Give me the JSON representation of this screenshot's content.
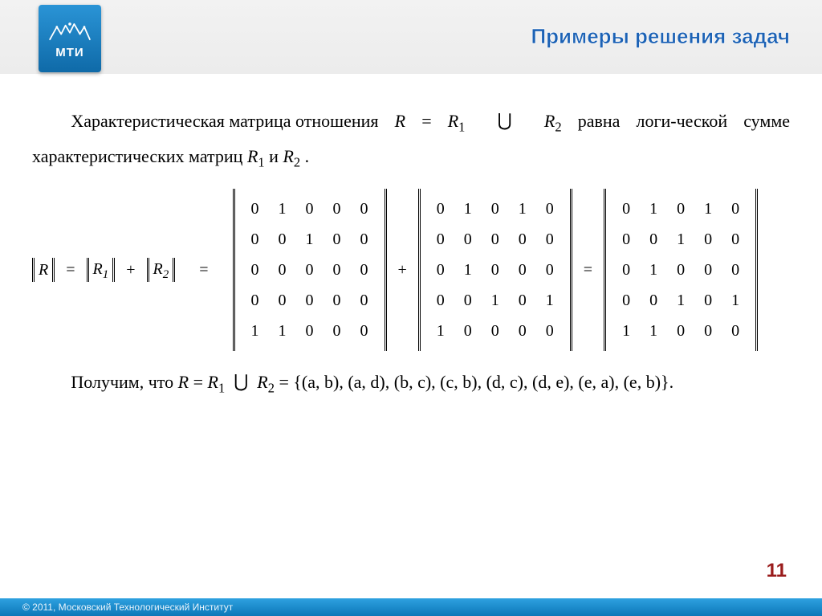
{
  "logo_text": "МТИ",
  "slide_title": "Примеры решения  задач",
  "para1_a": "Характеристическая матрица отношения ",
  "para1_b": " равна логи-ческой сумме характеристических матриц ",
  "para1_c": " и ",
  "para1_d": " .",
  "rel_eq": "R = R",
  "sub1": "1",
  "sub2": "2",
  "union": "⋃",
  "R": "R",
  "R1": "R ₁",
  "R2": "R ₂",
  "eq_lhs_a": "R",
  "eq_lhs_b": "R ",
  "eq_sign": "=",
  "plus": "+",
  "matrices": {
    "m1": [
      [
        0,
        1,
        0,
        0,
        0
      ],
      [
        0,
        0,
        1,
        0,
        0
      ],
      [
        0,
        0,
        0,
        0,
        0
      ],
      [
        0,
        0,
        0,
        0,
        0
      ],
      [
        1,
        1,
        0,
        0,
        0
      ]
    ],
    "m2": [
      [
        0,
        1,
        0,
        1,
        0
      ],
      [
        0,
        0,
        0,
        0,
        0
      ],
      [
        0,
        1,
        0,
        0,
        0
      ],
      [
        0,
        0,
        1,
        0,
        1
      ],
      [
        1,
        0,
        0,
        0,
        0
      ]
    ],
    "m3": [
      [
        0,
        1,
        0,
        1,
        0
      ],
      [
        0,
        0,
        1,
        0,
        0
      ],
      [
        0,
        1,
        0,
        0,
        0
      ],
      [
        0,
        0,
        1,
        0,
        1
      ],
      [
        1,
        1,
        0,
        0,
        0
      ]
    ]
  },
  "para2_a": "Получим, что ",
  "para2_b": " = {(a, b), (a, d), (b, c), (c, b), (d, c), (d, e), (e, a), (e, b)}.",
  "page_number": "11",
  "footer": "© 2011, Московский Технологический Институт"
}
